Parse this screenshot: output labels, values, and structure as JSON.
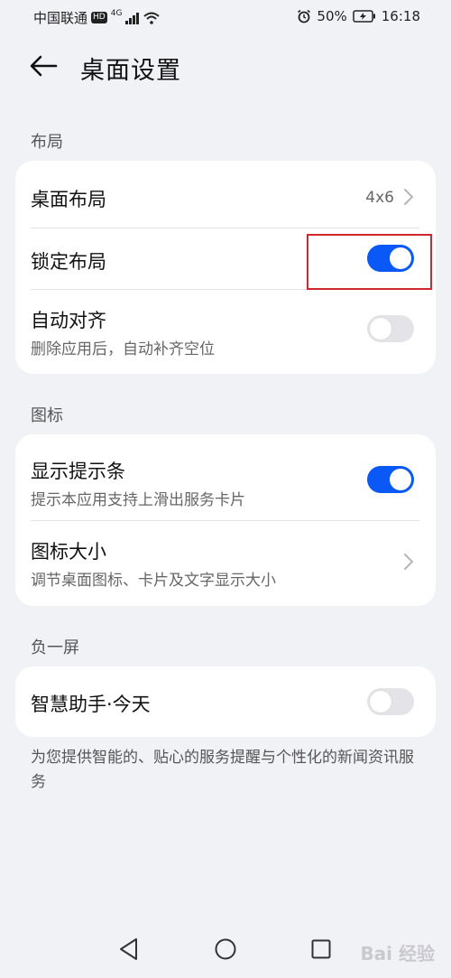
{
  "status_bar": {
    "carrier": "中国联通",
    "hd": "HD",
    "network": "4G",
    "battery": "50%",
    "time": "16:18"
  },
  "header": {
    "title": "桌面设置"
  },
  "sections": {
    "layout": {
      "label": "布局",
      "desktop_layout": {
        "title": "桌面布局",
        "value": "4x6"
      },
      "lock_layout": {
        "title": "锁定布局",
        "enabled": true
      },
      "auto_align": {
        "title": "自动对齐",
        "subtitle": "删除应用后，自动补齐空位",
        "enabled": false
      }
    },
    "icons": {
      "label": "图标",
      "show_hint_bar": {
        "title": "显示提示条",
        "subtitle": "提示本应用支持上滑出服务卡片",
        "enabled": true
      },
      "icon_size": {
        "title": "图标大小",
        "subtitle": "调节桌面图标、卡片及文字显示大小"
      }
    },
    "minus_one_screen": {
      "label": "负一屏",
      "smart_assistant": {
        "title": "智慧助手·今天",
        "enabled": false
      }
    }
  },
  "footnote": "为您提供智能的、贴心的服务提醒与个性化的新闻资讯服务",
  "watermark": "Bai 经验",
  "colors": {
    "accent": "#0a59f7",
    "highlight": "#d0272f",
    "background": "#f1f2f6"
  }
}
